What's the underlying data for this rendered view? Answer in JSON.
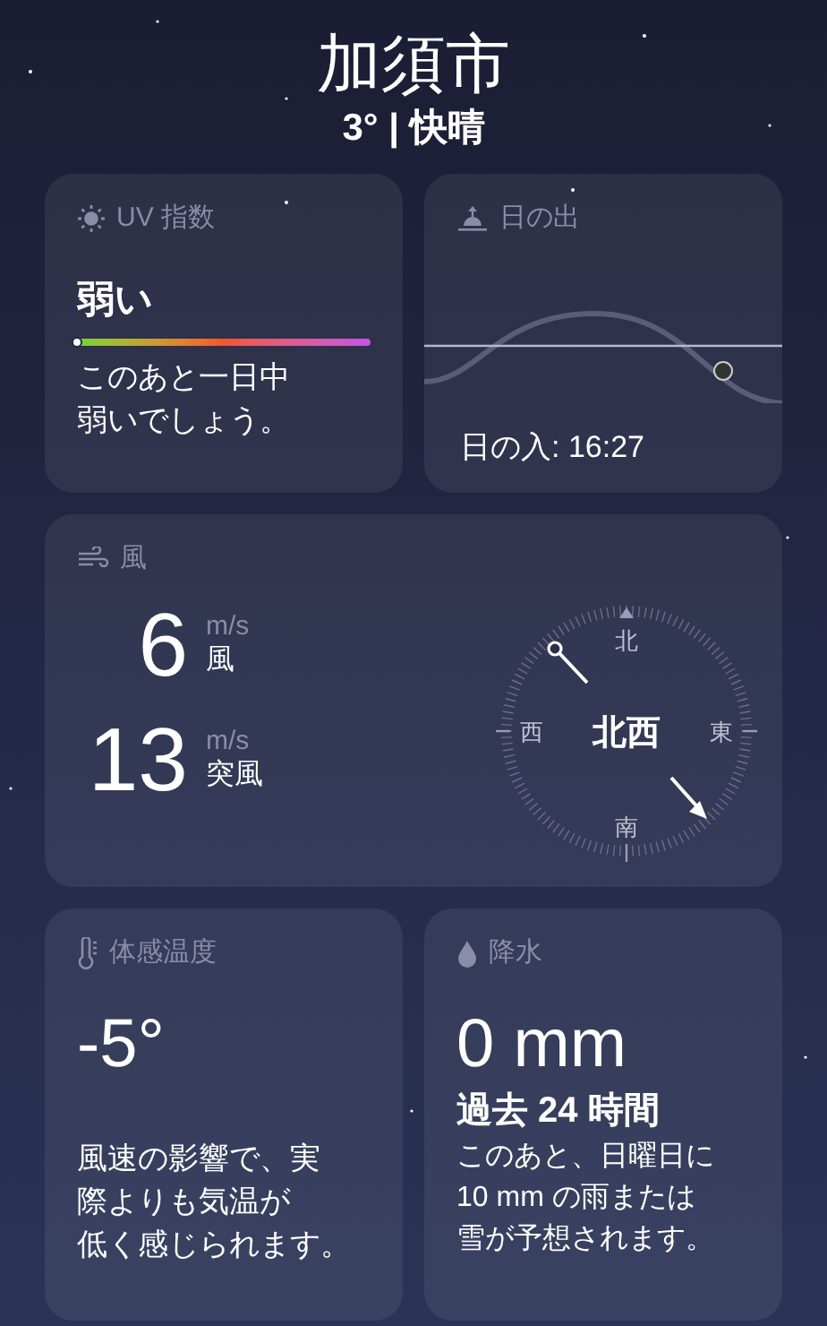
{
  "header": {
    "city": "加須市",
    "summary": "3° | 快晴"
  },
  "uv": {
    "title": "UV 指数",
    "category": "弱い",
    "level": 0,
    "description_lines": [
      "このあと一日中",
      "弱いでしょう。"
    ]
  },
  "sunrise": {
    "title": "日の出",
    "sunset": "日の入: 16:27"
  },
  "wind": {
    "title": "風",
    "readings": [
      {
        "value": "6",
        "unit": "m/s",
        "label": "風"
      },
      {
        "value": "13",
        "unit": "m/s",
        "label": "突風"
      }
    ],
    "compass": {
      "north": "北",
      "east": "東",
      "south": "南",
      "west": "西",
      "direction": "北西"
    }
  },
  "feels_like": {
    "title": "体感温度",
    "value": "-5°",
    "description_lines": [
      "風速の影響で、実",
      "際よりも気温が",
      "低く感じられます。"
    ]
  },
  "precipitation": {
    "title": "降水",
    "value": "0 mm",
    "period": "過去 24 時間",
    "description_lines": [
      "このあと、日曜日に",
      "10 mm の雨または",
      "雪が予想されます。"
    ]
  }
}
